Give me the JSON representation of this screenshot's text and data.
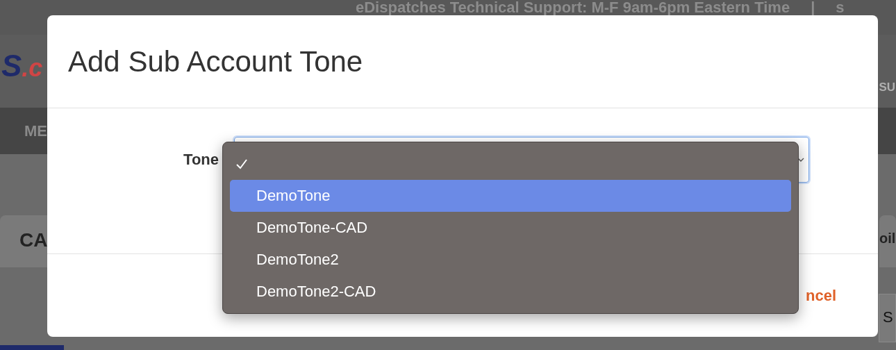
{
  "background": {
    "support_text": "eDispatches Technical Support: M-F 9am-6pm Eastern Time",
    "separator": "|",
    "top_right": "s",
    "logo": {
      "part_1": "S",
      "part_2": ".c"
    },
    "header_right": "SU",
    "nav_item": "ME",
    "tabs": [
      {
        "label": "CA"
      },
      {
        "label": "oil"
      }
    ],
    "side_text": "S"
  },
  "dialog": {
    "title": "Add Sub Account Tone",
    "field_label": "Tone",
    "dropdown": {
      "blank_option": {
        "checked": true
      },
      "options": [
        {
          "label": "DemoTone",
          "highlighted": true
        },
        {
          "label": "DemoTone-CAD",
          "highlighted": false
        },
        {
          "label": "DemoTone2",
          "highlighted": false
        },
        {
          "label": "DemoTone2-CAD",
          "highlighted": false
        }
      ]
    },
    "cancel": "ncel"
  }
}
